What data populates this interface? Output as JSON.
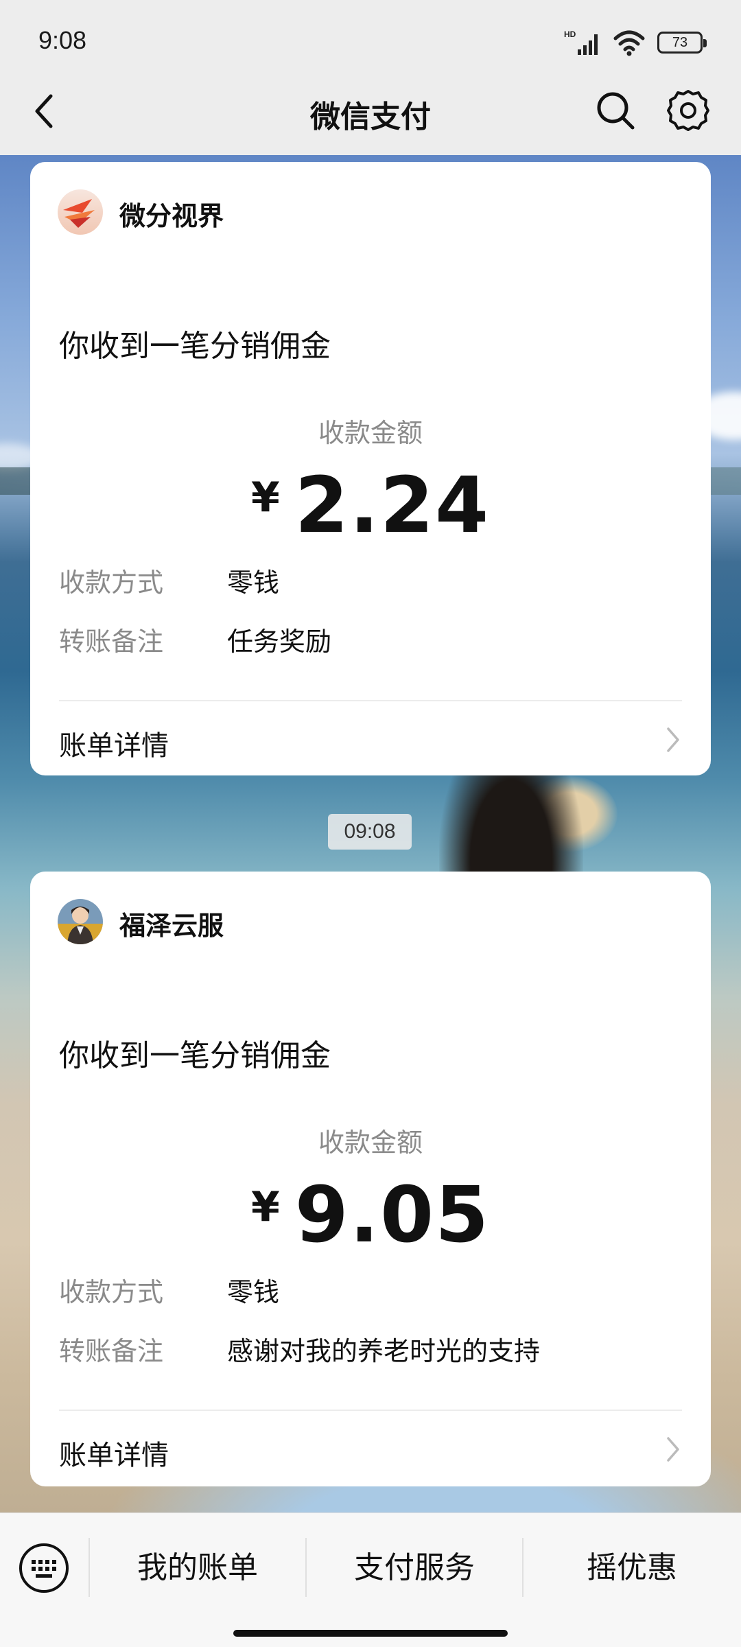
{
  "status_bar": {
    "time": "9:08",
    "network_label": "HD",
    "battery_level": "73"
  },
  "nav": {
    "title": "微信支付",
    "back_icon": "chevron-left-icon",
    "search_icon": "search-icon",
    "settings_icon": "gear-icon"
  },
  "messages": [
    {
      "merchant": "微分视界",
      "title": "你收到一笔分销佣金",
      "amount_label": "收款金额",
      "currency": "¥",
      "amount": "2.24",
      "rows": [
        {
          "label": "收款方式",
          "value": "零钱"
        },
        {
          "label": "转账备注",
          "value": "任务奖励"
        }
      ],
      "detail_label": "账单详情"
    },
    {
      "merchant": "福泽云服",
      "title": "你收到一笔分销佣金",
      "amount_label": "收款金额",
      "currency": "¥",
      "amount": "9.05",
      "rows": [
        {
          "label": "收款方式",
          "value": "零钱"
        },
        {
          "label": "转账备注",
          "value": "感谢对我的养老时光的支持"
        }
      ],
      "detail_label": "账单详情"
    }
  ],
  "timestamp": "09:08",
  "bottom_bar": {
    "keyboard_icon": "keyboard-icon",
    "tabs": [
      "我的账单",
      "支付服务",
      "摇优惠"
    ]
  }
}
